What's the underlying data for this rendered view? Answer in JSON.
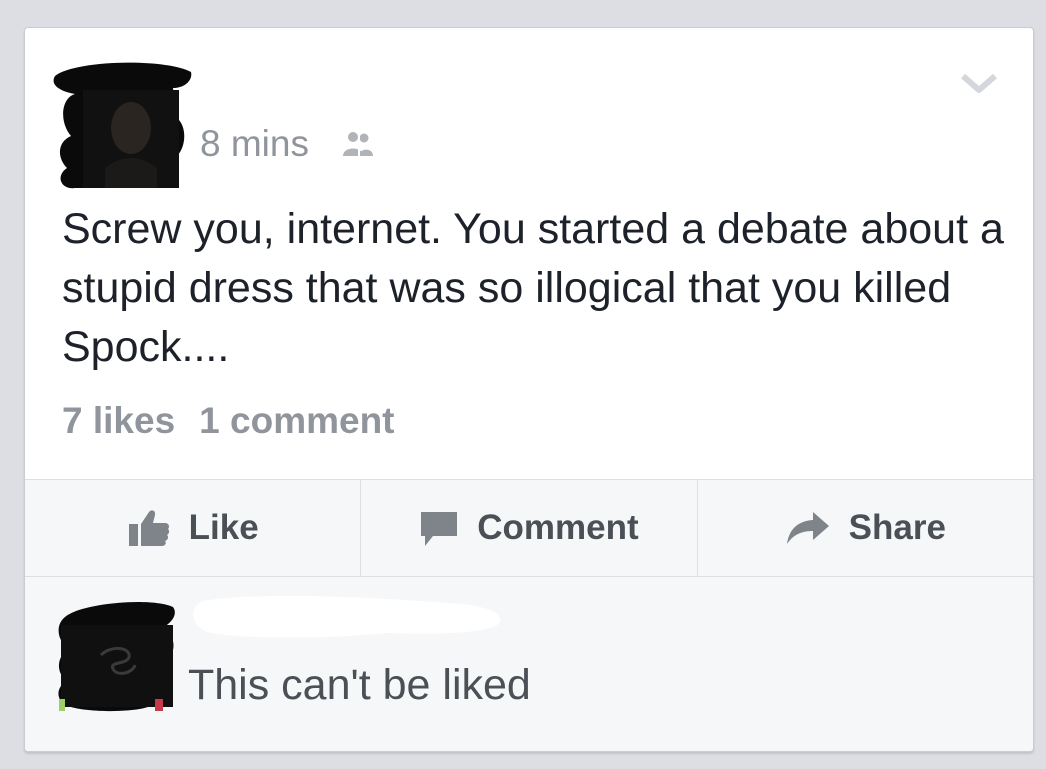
{
  "post": {
    "timestamp": "8 mins",
    "audience_icon": "friends-icon",
    "menu_icon": "chevron-down-icon",
    "text": "Screw you, internet. You started a debate about a stupid dress that was so illogical that you killed Spock....",
    "likes": "7 likes",
    "comments": "1 comment"
  },
  "actions": {
    "like_label": "Like",
    "comment_label": "Comment",
    "share_label": "Share"
  },
  "comment": {
    "text": "This can't be liked"
  },
  "colors": {
    "background": "#dcdee3",
    "text_primary": "#1d2129",
    "text_secondary": "#90949c",
    "action_text": "#4b4f56"
  }
}
